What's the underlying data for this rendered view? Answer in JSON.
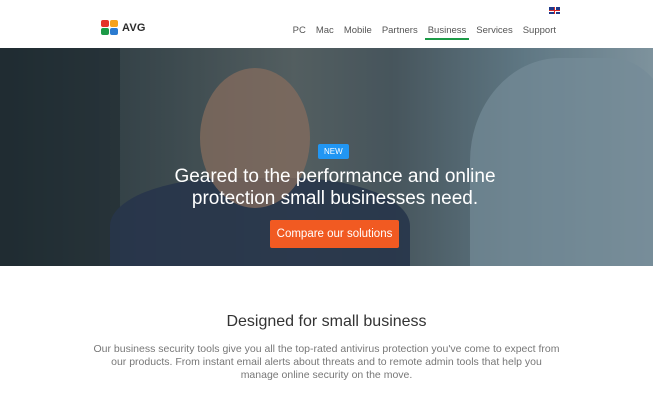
{
  "brand": {
    "logo_text": "AVG"
  },
  "header": {
    "language_flag": "uk-flag-icon",
    "nav": [
      {
        "label": "PC",
        "active": false
      },
      {
        "label": "Mac",
        "active": false
      },
      {
        "label": "Mobile",
        "active": false
      },
      {
        "label": "Partners",
        "active": false
      },
      {
        "label": "Business",
        "active": true
      },
      {
        "label": "Services",
        "active": false
      },
      {
        "label": "Support",
        "active": false
      }
    ],
    "active_underline_color": "#1c9a47"
  },
  "hero": {
    "badge": "NEW",
    "title_line1": "Geared to the performance and online",
    "title_line2": "protection small businesses need.",
    "cta_label": "Compare our solutions",
    "badge_color": "#2196f3",
    "cta_color": "#f15a22"
  },
  "content": {
    "heading": "Designed for small business",
    "body_line1": "Our business security tools give you all the top-rated antivirus protection you've come to expect from",
    "body_line2": "our products. From instant email alerts about threats and to remote admin tools that help you",
    "body_line3": "manage online security on the move."
  }
}
